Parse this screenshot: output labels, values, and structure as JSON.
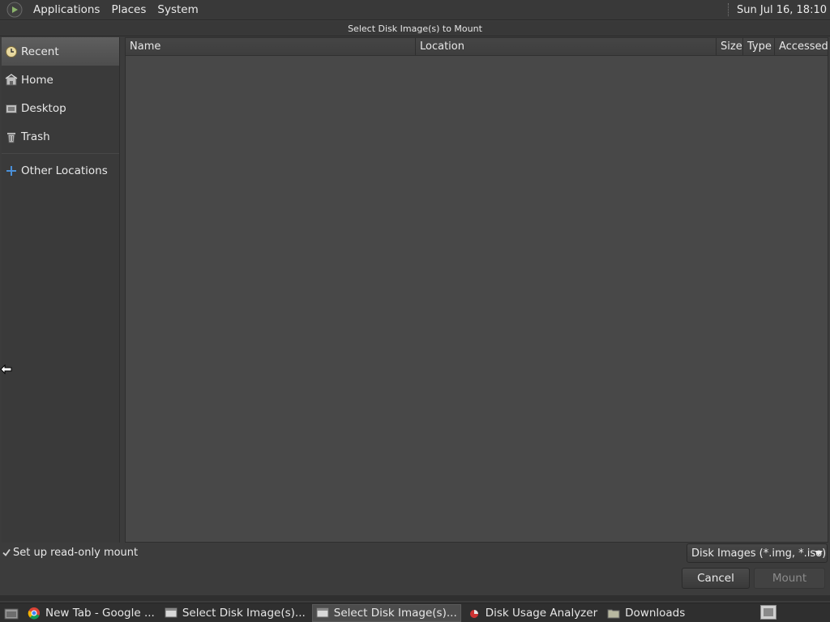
{
  "top_panel": {
    "menus": [
      "Applications",
      "Places",
      "System"
    ],
    "clock": "Sun Jul 16, 18:10"
  },
  "dialog": {
    "title": "Select Disk Image(s) to Mount"
  },
  "sidebar": {
    "items": [
      {
        "label": "Recent",
        "icon": "recent-icon",
        "active": true
      },
      {
        "label": "Home",
        "icon": "home-icon"
      },
      {
        "label": "Desktop",
        "icon": "desktop-icon"
      },
      {
        "label": "Trash",
        "icon": "trash-icon"
      }
    ],
    "other": {
      "label": "Other Locations",
      "icon": "plus-icon"
    }
  },
  "file_list": {
    "columns": [
      "Name",
      "Location",
      "Size",
      "Type",
      "Accessed"
    ],
    "rows": []
  },
  "options": {
    "readonly_label": "Set up read-only mount",
    "readonly_checked": true,
    "filter_value": "Disk Images (*.img, *.iso)"
  },
  "buttons": {
    "cancel": "Cancel",
    "mount": "Mount"
  },
  "taskbar": {
    "tasks": [
      {
        "label": "New Tab - Google ...",
        "icon": "chrome-icon"
      },
      {
        "label": "Select Disk Image(s)...",
        "icon": "window-icon"
      },
      {
        "label": "Select Disk Image(s)...",
        "icon": "window-icon",
        "active": true
      },
      {
        "label": "Disk Usage Analyzer",
        "icon": "disk-usage-icon"
      },
      {
        "label": "Downloads",
        "icon": "folder-icon"
      }
    ]
  },
  "colors": {
    "accent_blue": "#4a90d9",
    "background": "#3c3c3c",
    "file_pane": "#484848"
  }
}
